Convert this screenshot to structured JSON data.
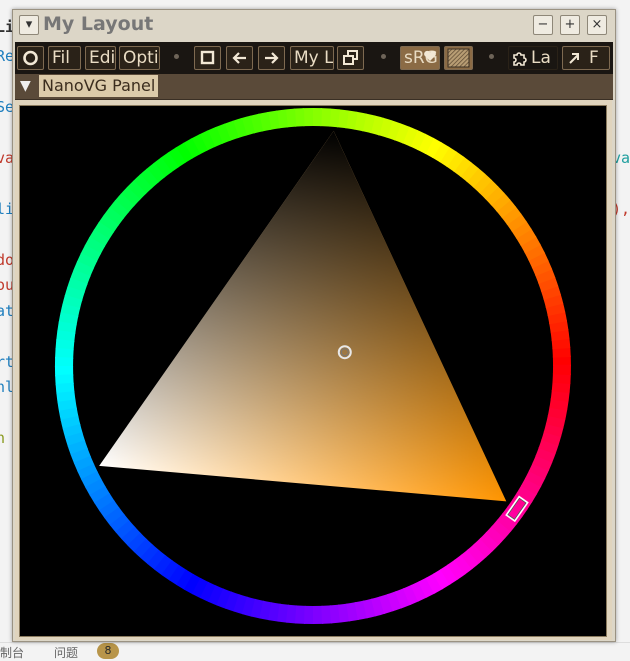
{
  "window": {
    "title": "My Layout",
    "buttons": {
      "collapse": "▾",
      "minimize": "−",
      "dock": "+",
      "close": "×"
    }
  },
  "toolbar": {
    "file": "Fil",
    "edit": "Edi",
    "options": "Opti",
    "layout_select": "My L",
    "color_space": "sRG",
    "layers": "La",
    "float": "F"
  },
  "panel": {
    "toggle": "▼",
    "title": "NanoVG Panel"
  },
  "status_bar": {
    "console_tab": "制台",
    "problems_tab": "问题",
    "problems_count": "8"
  },
  "background_code": {
    "snippets": [
      "Li",
      "Re",
      "Se",
      "va",
      "lis",
      "do",
      "ou",
      "at",
      "rt",
      "nl",
      "n",
      "va",
      "),"
    ]
  },
  "color_wheel": {
    "hue_degrees": 35,
    "saturation": 0.62,
    "value": 0.62
  },
  "icons": {
    "circle": "record-icon",
    "square": "square-icon",
    "back": "arrow-left-icon",
    "forward": "arrow-right-icon",
    "windows": "windows-icon",
    "heart": "heart-icon",
    "texture": "texture-icon",
    "puzzle": "puzzle-icon",
    "launch": "arrow-up-right-icon"
  }
}
